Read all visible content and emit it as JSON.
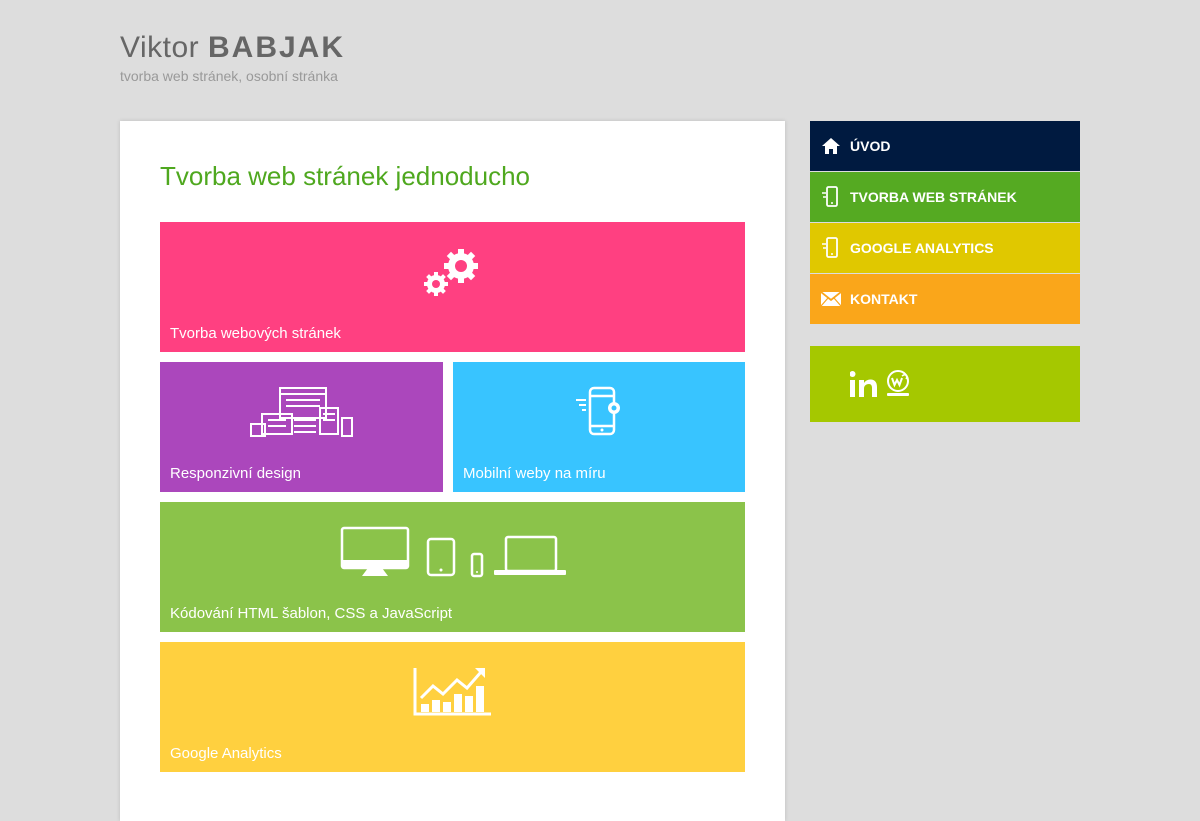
{
  "header": {
    "first_name": "Viktor",
    "last_name": "BABJAK",
    "subtitle": "tvorba web stránek, osobní stránka"
  },
  "main": {
    "heading": "Tvorba web stránek jednoducho",
    "tiles": [
      {
        "label": "Tvorba webových stránek",
        "color": "#ff4081",
        "icon": "gears-icon"
      },
      {
        "label": "Responzivní design",
        "color": "#ab47bc",
        "icon": "responsive-devices-icon"
      },
      {
        "label": "Mobilní weby na míru",
        "color": "#38c4ff",
        "icon": "mobile-settings-icon"
      },
      {
        "label": "Kódování HTML šablon, CSS a JavaScript",
        "color": "#8bc34a",
        "icon": "devices-icon"
      },
      {
        "label": "Google Analytics",
        "color": "#ffd03f",
        "icon": "growth-chart-icon"
      }
    ]
  },
  "nav": {
    "items": [
      {
        "label": "ÚVOD",
        "color": "#001a40",
        "icon": "home-icon"
      },
      {
        "label": "TVORBA WEB STRÁNEK",
        "color": "#55aa22",
        "icon": "mobile-touch-icon"
      },
      {
        "label": "GOOGLE ANALYTICS",
        "color": "#e0c800",
        "icon": "mobile-touch-icon"
      },
      {
        "label": "KONTAKT",
        "color": "#faa61a",
        "icon": "envelope-icon"
      }
    ]
  },
  "social": {
    "color": "#a5c800",
    "links": [
      {
        "label": "in",
        "icon": "linkedin-icon"
      },
      {
        "label": "WEDOS",
        "icon": "wedos-icon"
      }
    ]
  }
}
